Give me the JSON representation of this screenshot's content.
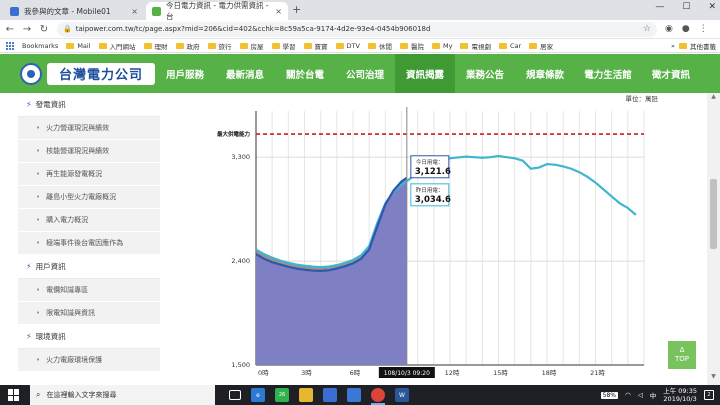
{
  "browser": {
    "tabs": [
      {
        "title": "我參與的文章 - Mobile01",
        "favicon_color": "#3b6fd1"
      },
      {
        "title": "今日電力資訊 - 電力供需資訊 - 台",
        "favicon_color": "#56b146"
      }
    ],
    "new_tab_glyph": "+",
    "close_glyph": "×",
    "window_controls": [
      "—",
      "☐",
      "✕"
    ],
    "url": "taipower.com.tw/tc/page.aspx?mid=206&cid=402&cchk=8c59a5ca-9174-4d2e-93e4-0454b906018d",
    "bookmarks_label": "Bookmarks",
    "bookmarks": [
      "Mail",
      "入門網站",
      "理財",
      "政府",
      "旅行",
      "房屋",
      "學習",
      "寶寶",
      "DTV",
      "休閒",
      "醫院",
      "My",
      "電視劇",
      "Car",
      "居家"
    ],
    "other_bookmarks": "其他書籤"
  },
  "site": {
    "logo_text": "台灣電力公司",
    "nav": [
      "用戶服務",
      "最新消息",
      "關於台電",
      "公司治理",
      "資訊揭露",
      "業務公告",
      "規章條款",
      "電力生活館",
      "徵才資訊"
    ],
    "active_nav": "資訊揭露",
    "accent_green": "#56b146",
    "accent_blue": "#2a63b6"
  },
  "sidebar": {
    "sections": [
      {
        "title": "發電資訊",
        "items": [
          "火力營運現況與績效",
          "核能營運現況與績效",
          "再生能源發電概況",
          "離島小型火力電廠概況",
          "購入電力概況",
          "極端事件後台電因應作為"
        ]
      },
      {
        "title": "用戶資訊",
        "items": [
          "電價知識專區",
          "限電知識與資訊"
        ]
      },
      {
        "title": "環境資訊",
        "items": [
          "火力電廠環境保護"
        ]
      }
    ]
  },
  "chart_data": {
    "type": "area",
    "unit_label": "單位：萬瓩",
    "x_ticks": [
      "0時",
      "3時",
      "6時",
      "9時",
      "12時",
      "15時",
      "18時",
      "21時"
    ],
    "xlim": [
      0,
      24
    ],
    "y_ticks": [
      1500,
      2400,
      3300
    ],
    "ylim": [
      1500,
      3700
    ],
    "max_supply": {
      "label": "最大供電能力",
      "value": 3500
    },
    "cursor": {
      "time": "108/10/3 09:20",
      "x": 9.33
    },
    "tooltips": [
      {
        "label": "今日用電：",
        "value": "3,121.6"
      },
      {
        "label": "昨日用電：",
        "value": "3,034.6"
      }
    ],
    "series": [
      {
        "name": "今日用電",
        "color": "#2f56b0",
        "fill": "#7f7fc4",
        "x": [
          0,
          0.5,
          1,
          1.5,
          2,
          2.5,
          3,
          3.5,
          4,
          4.5,
          5,
          5.5,
          6,
          6.5,
          7,
          7.5,
          8,
          8.5,
          9,
          9.33
        ],
        "y": [
          2460,
          2420,
          2390,
          2370,
          2350,
          2335,
          2325,
          2318,
          2315,
          2320,
          2335,
          2355,
          2380,
          2420,
          2500,
          2700,
          2890,
          3010,
          3090,
          3121.6
        ]
      },
      {
        "name": "昨日用電",
        "color": "#3fb5d0",
        "fill": "#8f7d6a",
        "x": [
          0,
          0.5,
          1,
          1.5,
          2,
          2.5,
          3,
          3.5,
          4,
          4.5,
          5,
          5.5,
          6,
          6.5,
          7,
          7.5,
          8,
          8.5,
          9,
          9.5,
          10,
          10.5,
          11,
          11.5,
          12,
          12.5,
          13,
          13.5,
          14,
          14.5,
          15,
          15.5,
          16,
          16.5,
          17,
          17.5,
          18,
          18.5,
          19,
          19.5,
          20,
          20.5,
          21,
          21.5,
          22,
          22.5,
          23,
          23.5
        ],
        "y": [
          2500,
          2460,
          2430,
          2405,
          2385,
          2370,
          2360,
          2352,
          2348,
          2352,
          2365,
          2385,
          2410,
          2450,
          2530,
          2730,
          2900,
          3000,
          3060,
          3110,
          3170,
          3230,
          3260,
          3280,
          3290,
          3298,
          3305,
          3300,
          3295,
          3300,
          3310,
          3300,
          3290,
          3270,
          3200,
          3210,
          3240,
          3235,
          3220,
          3200,
          3170,
          3130,
          3080,
          3020,
          2960,
          2900,
          2860,
          2800
        ]
      }
    ]
  },
  "scroll_top": {
    "arrow": "Δ",
    "label": "TOP"
  },
  "taskbar": {
    "search_placeholder": "在這裡輸入文字來搜尋",
    "battery": "58%",
    "ime": "中",
    "time": "上午 09:35",
    "date": "2019/10/3",
    "notifications": "2",
    "badge": "26"
  }
}
